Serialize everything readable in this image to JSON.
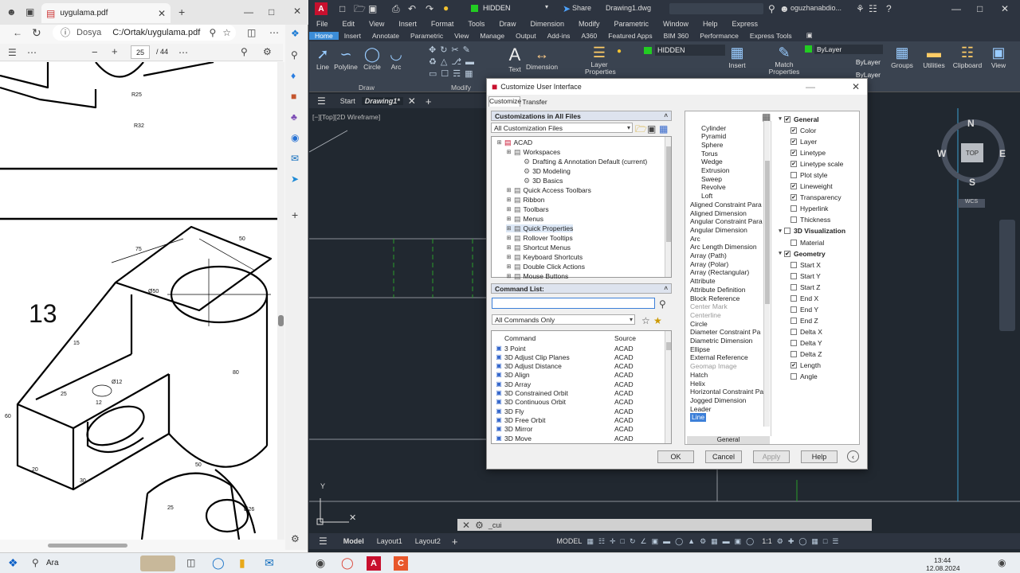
{
  "browser": {
    "tab_title": "uygulama.pdf",
    "address_label": "Dosya",
    "address_url": "C:/Ortak/uygulama.pdf",
    "page_current": "25",
    "page_total": "/ 44"
  },
  "pdf": {
    "labels": [
      "R25",
      "R32",
      "13",
      "Ø50",
      "50",
      "75",
      "15",
      "Ø12",
      "25",
      "12",
      "60",
      "20",
      "80",
      "30",
      "50",
      "Ø26",
      "25"
    ]
  },
  "acad": {
    "layer_name": "HIDDEN",
    "share_label": "Share",
    "file_title": "Drawing1.dwg",
    "user": "oguzhanabdio...",
    "menu": [
      "File",
      "Edit",
      "View",
      "Insert",
      "Format",
      "Tools",
      "Draw",
      "Dimension",
      "Modify",
      "Parametric",
      "Window",
      "Help",
      "Express"
    ],
    "ribbon_tabs": [
      "Home",
      "Insert",
      "Annotate",
      "Parametric",
      "View",
      "Manage",
      "Output",
      "Add-ins",
      "A360",
      "Featured Apps",
      "BIM 360",
      "Performance",
      "Express Tools"
    ],
    "ribbon_active": "Home",
    "draw_tools": [
      "Line",
      "Polyline",
      "Circle",
      "Arc"
    ],
    "annot_tools": [
      "Text",
      "Dimension"
    ],
    "layer_props": "Layer Properties",
    "draw_group": "Draw",
    "modify_group": "Modify",
    "insert_label": "Insert",
    "match_props": "Match Properties",
    "bylayer": [
      "ByLayer",
      "ByLayer",
      "ByLayer"
    ],
    "groups_right": [
      "Groups",
      "Utilities",
      "Clipboard",
      "View"
    ],
    "doc_tabs": [
      "Start",
      "Drawing1*"
    ],
    "viewport_label": "[−][Top][2D Wireframe]",
    "compass": {
      "n": "N",
      "s": "S",
      "e": "E",
      "w": "W",
      "top": "TOP",
      "wcs": "WCS"
    },
    "cmd_placeholder": "_cui",
    "layout_tabs": [
      "Model",
      "Layout1",
      "Layout2"
    ],
    "status_model": "MODEL",
    "status_scale": "1:1"
  },
  "dialog": {
    "title": "Customize User Interface",
    "tabs": [
      "Customize",
      "Transfer"
    ],
    "cust_header": "Customizations in All Files",
    "cust_filter": "All Customization Files",
    "tree": [
      {
        "label": "ACAD",
        "indent": 0
      },
      {
        "label": "Workspaces",
        "indent": 1
      },
      {
        "label": "Drafting & Annotation Default (current)",
        "indent": 2
      },
      {
        "label": "3D Modeling",
        "indent": 2
      },
      {
        "label": "3D Basics",
        "indent": 2
      },
      {
        "label": "Quick Access Toolbars",
        "indent": 1
      },
      {
        "label": "Ribbon",
        "indent": 1
      },
      {
        "label": "Toolbars",
        "indent": 1
      },
      {
        "label": "Menus",
        "indent": 1
      },
      {
        "label": "Quick Properties",
        "indent": 1
      },
      {
        "label": "Rollover Tooltips",
        "indent": 1
      },
      {
        "label": "Shortcut Menus",
        "indent": 1
      },
      {
        "label": "Keyboard Shortcuts",
        "indent": 1
      },
      {
        "label": "Double Click Actions",
        "indent": 1
      },
      {
        "label": "Mouse Buttons",
        "indent": 1
      }
    ],
    "cmd_header": "Command List:",
    "cmd_filter": "All Commands Only",
    "cmd_cols": [
      "Command",
      "Source"
    ],
    "commands": [
      [
        "3 Point",
        "ACAD"
      ],
      [
        "3D Adjust Clip Planes",
        "ACAD"
      ],
      [
        "3D Adjust Distance",
        "ACAD"
      ],
      [
        "3D Align",
        "ACAD"
      ],
      [
        "3D Array",
        "ACAD"
      ],
      [
        "3D Constrained Orbit",
        "ACAD"
      ],
      [
        "3D Continuous Orbit",
        "ACAD"
      ],
      [
        "3D Fly",
        "ACAD"
      ],
      [
        "3D Free Orbit",
        "ACAD"
      ],
      [
        "3D Mirror",
        "ACAD"
      ],
      [
        "3D Move",
        "ACAD"
      ]
    ],
    "objects": [
      "Cylinder",
      "Pyramid",
      "Sphere",
      "Torus",
      "Wedge",
      "Extrusion",
      "Sweep",
      "Revolve",
      "Loft",
      "Aligned Constraint Para",
      "Aligned Dimension",
      "Angular Constraint Para",
      "Angular Dimension",
      "Arc",
      "Arc Length Dimension",
      "Array (Path)",
      "Array (Polar)",
      "Array (Rectangular)",
      "Attribute",
      "Attribute Definition",
      "Block Reference",
      "Center Mark",
      "Centerline",
      "Circle",
      "Diameter Constraint Pa",
      "Diametric Dimension",
      "Ellipse",
      "External Reference",
      "Geomap Image",
      "Hatch",
      "Helix",
      "Horizontal Constraint Pa",
      "Jogged Dimension",
      "Leader",
      "Line"
    ],
    "objects_grey": [
      "Center Mark",
      "Centerline",
      "Geomap Image"
    ],
    "objects_indent": 9,
    "objects_selected": "Line",
    "objects_footer": "General",
    "props": [
      {
        "label": "General",
        "type": "group",
        "checked": true
      },
      {
        "label": "Color",
        "checked": true
      },
      {
        "label": "Layer",
        "checked": true
      },
      {
        "label": "Linetype",
        "checked": true
      },
      {
        "label": "Linetype scale",
        "checked": true
      },
      {
        "label": "Plot style",
        "checked": false
      },
      {
        "label": "Lineweight",
        "checked": true
      },
      {
        "label": "Transparency",
        "checked": true
      },
      {
        "label": "Hyperlink",
        "checked": false
      },
      {
        "label": "Thickness",
        "checked": false
      },
      {
        "label": "3D Visualization",
        "type": "group",
        "checked": false
      },
      {
        "label": "Material",
        "checked": false
      },
      {
        "label": "Geometry",
        "type": "group",
        "checked": true
      },
      {
        "label": "Start X",
        "checked": false
      },
      {
        "label": "Start Y",
        "checked": false
      },
      {
        "label": "Start Z",
        "checked": false
      },
      {
        "label": "End X",
        "checked": false
      },
      {
        "label": "End Y",
        "checked": false
      },
      {
        "label": "End Z",
        "checked": false
      },
      {
        "label": "Delta X",
        "checked": false
      },
      {
        "label": "Delta Y",
        "checked": false
      },
      {
        "label": "Delta Z",
        "checked": false
      },
      {
        "label": "Length",
        "checked": true
      },
      {
        "label": "Angle",
        "checked": false
      }
    ],
    "buttons": [
      "OK",
      "Cancel",
      "Apply",
      "Help"
    ]
  },
  "taskbar": {
    "search": "Ara",
    "time": "13:44",
    "date": "12.08.2024"
  },
  "colors": {
    "acad_accent": "#3c8dd8",
    "layer_green": "#22cc22",
    "autocad_red": "#c8102e"
  }
}
